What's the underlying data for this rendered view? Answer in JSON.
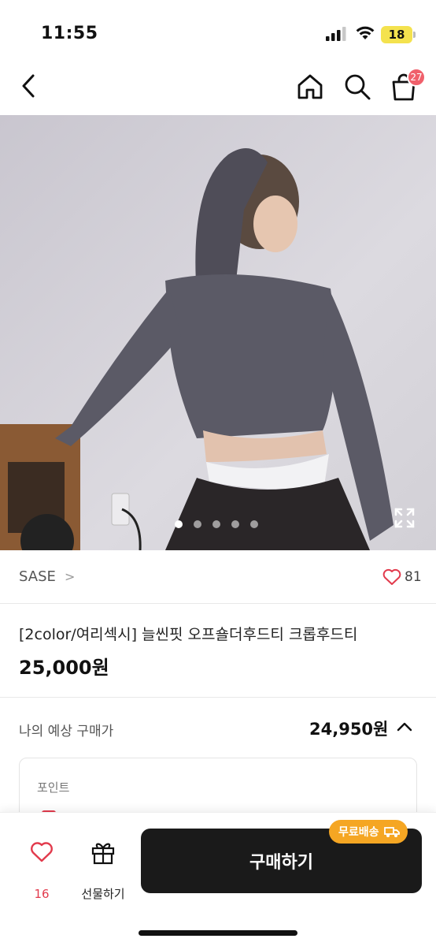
{
  "status_bar": {
    "time": "11:55",
    "battery": "18"
  },
  "nav": {
    "cart_count": "27"
  },
  "gallery": {
    "page_count": 5,
    "active_index": 0
  },
  "brand": {
    "name": "SASE",
    "chevron": ">",
    "likes": "81"
  },
  "product": {
    "title": "[2color/여리섹시] 늘씬핏 오프숄더후드티 크롭후드티",
    "price": "25,000원"
  },
  "expected_price": {
    "label": "나의 예상 구매가",
    "value": "24,950원"
  },
  "points": {
    "label": "포인트"
  },
  "bottom_bar": {
    "wish_count": "16",
    "gift_label": "선물하기",
    "buy_label": "구매하기",
    "free_shipping_label": "무료배송"
  },
  "colors": {
    "accent_red": "#e23a4c",
    "badge_pink": "#f0606b",
    "shipping_orange": "#f5a623",
    "buy_button": "#1a1a1a"
  },
  "icons": [
    "back-icon",
    "home-icon",
    "search-icon",
    "cart-icon",
    "expand-icon",
    "heart-icon",
    "chevron-up-icon",
    "gift-icon",
    "truck-icon"
  ]
}
